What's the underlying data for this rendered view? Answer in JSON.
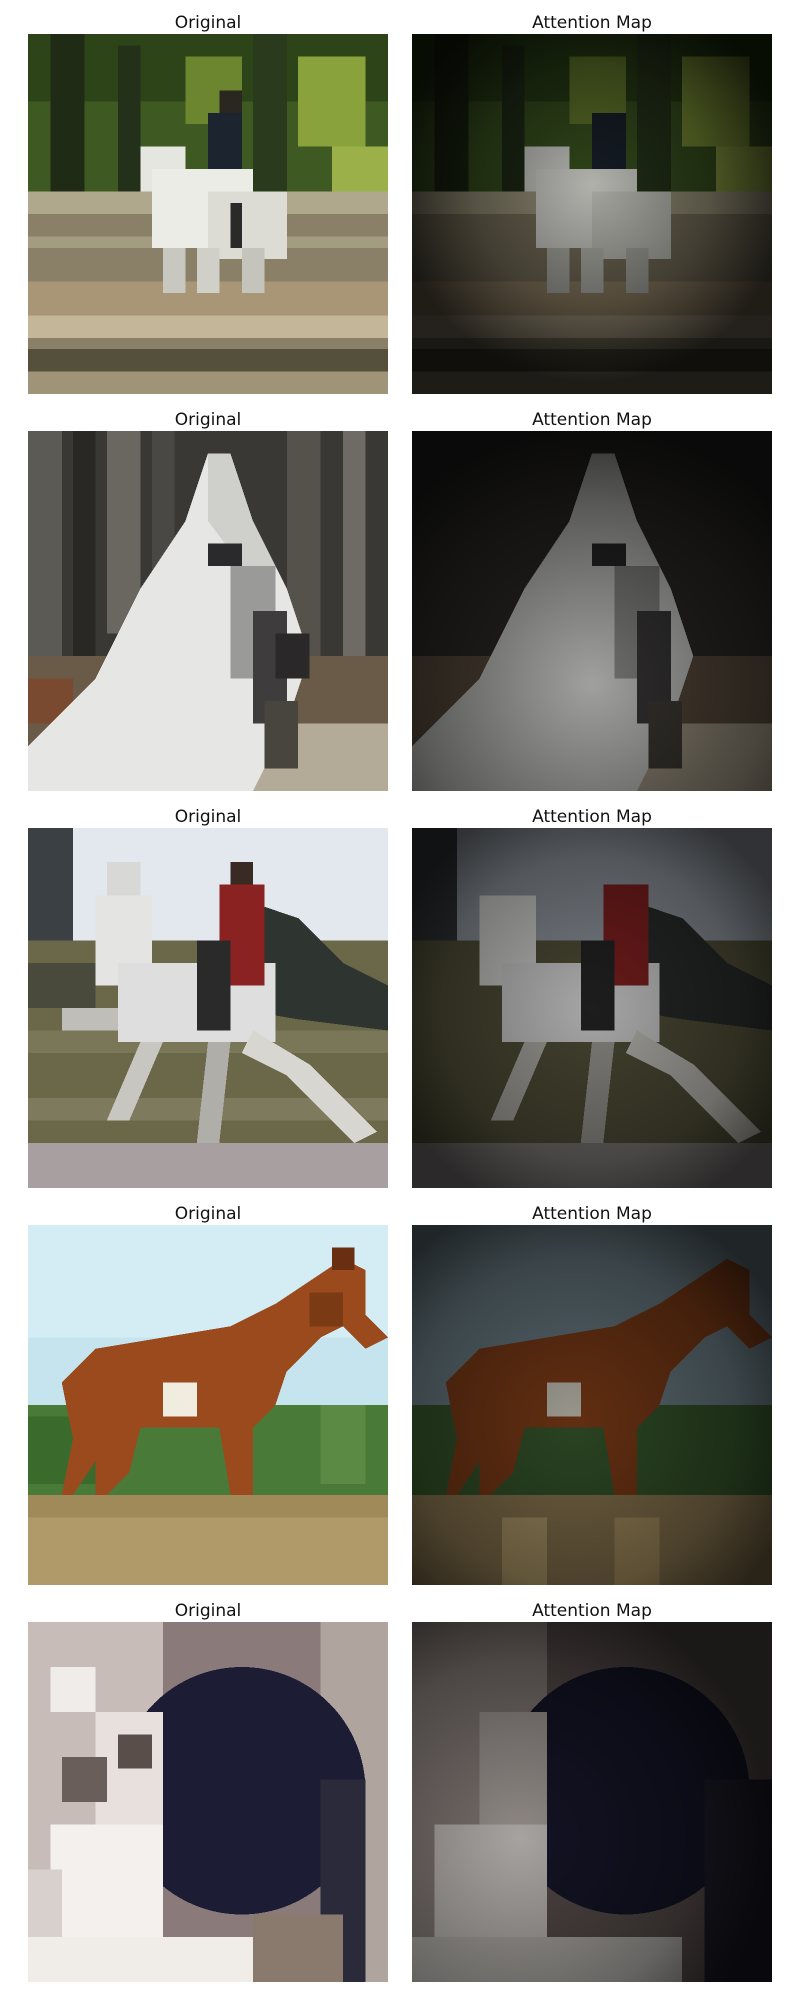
{
  "figure": {
    "rows": [
      {
        "subject": "white horse with rider behind fence",
        "original": {
          "title": "Original"
        },
        "attention": {
          "title": "Attention Map"
        }
      },
      {
        "subject": "close-up of white horse head with bridle",
        "original": {
          "title": "Original"
        },
        "attention": {
          "title": "Attention Map"
        }
      },
      {
        "subject": "white horse with rider in red jacket",
        "original": {
          "title": "Original"
        },
        "attention": {
          "title": "Attention Map"
        }
      },
      {
        "subject": "brown horse standing in field",
        "original": {
          "title": "Original"
        },
        "attention": {
          "title": "Attention Map"
        }
      },
      {
        "subject": "cat next to dark round object",
        "original": {
          "title": "Original"
        },
        "attention": {
          "title": "Attention Map"
        }
      }
    ]
  }
}
